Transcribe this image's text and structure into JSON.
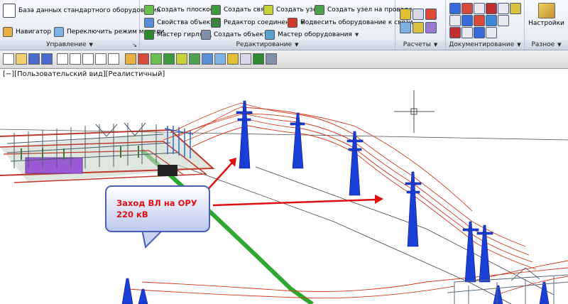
{
  "ribbon": {
    "control": {
      "title": "Управление",
      "db_button": "База данных стандартного оборудования",
      "navigator_button": "Навигатор",
      "switch_mode_button": "Переключить режим модели"
    },
    "edit": {
      "title": "Редактирование",
      "create_plane": "Создать плоскость",
      "create_link": "Создать связь",
      "create_node": "Создать узел",
      "create_node_on_wire": "Создать узел на проводе",
      "object_props": "Свойства объекта",
      "link_editor": "Редактор соединений",
      "hang_equipment": "Подвесить оборудование к связи",
      "garland_wizard": "Мастер гирлянд",
      "create_object": "Создать объект",
      "equipment_wizard": "Мастер оборудования"
    },
    "calc": {
      "title": "Расчеты"
    },
    "docs": {
      "title": "Документирование"
    },
    "misc": {
      "title": "Разное",
      "settings_button": "Настройки"
    }
  },
  "viewport": {
    "view_label": "[−][Пользовательский вид][Реалистичный]",
    "callout_line1": "Заход ВЛ на ОРУ",
    "callout_line2": "220 кВ"
  },
  "colors": {
    "accent_red": "#e01010",
    "tower_blue": "#1a3fd6",
    "wire_red": "#d23a1e",
    "ground_green": "#2fa82f",
    "callout_border": "#4a5fb5"
  }
}
